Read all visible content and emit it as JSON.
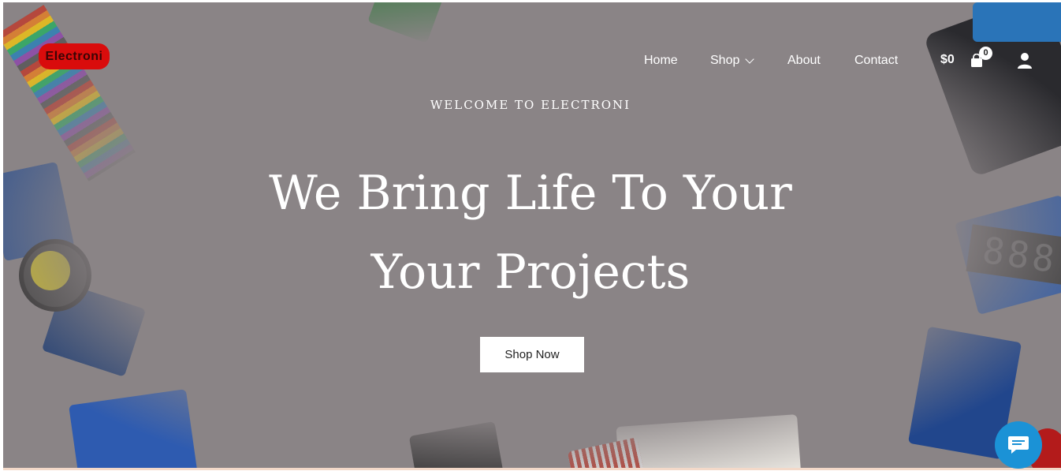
{
  "brand": {
    "logo_text": "Electroni"
  },
  "nav": {
    "items": [
      {
        "label": "Home"
      },
      {
        "label": "Shop"
      },
      {
        "label": "About"
      },
      {
        "label": "Contact"
      }
    ]
  },
  "cart": {
    "total": "$0",
    "count": "0"
  },
  "hero": {
    "eyebrow": "WELCOME TO ELECTRONI",
    "headline_line1": "We Bring Life To Your",
    "headline_line2": "Your Projects",
    "cta_label": "Shop Now"
  },
  "colors": {
    "logo_bg": "#d90c0c",
    "chat_button": "#1b92d6",
    "hero_overlay": "#8a8486"
  },
  "icons": [
    "chevron-down-icon",
    "shopping-bag-icon",
    "user-icon",
    "chat-icon"
  ]
}
